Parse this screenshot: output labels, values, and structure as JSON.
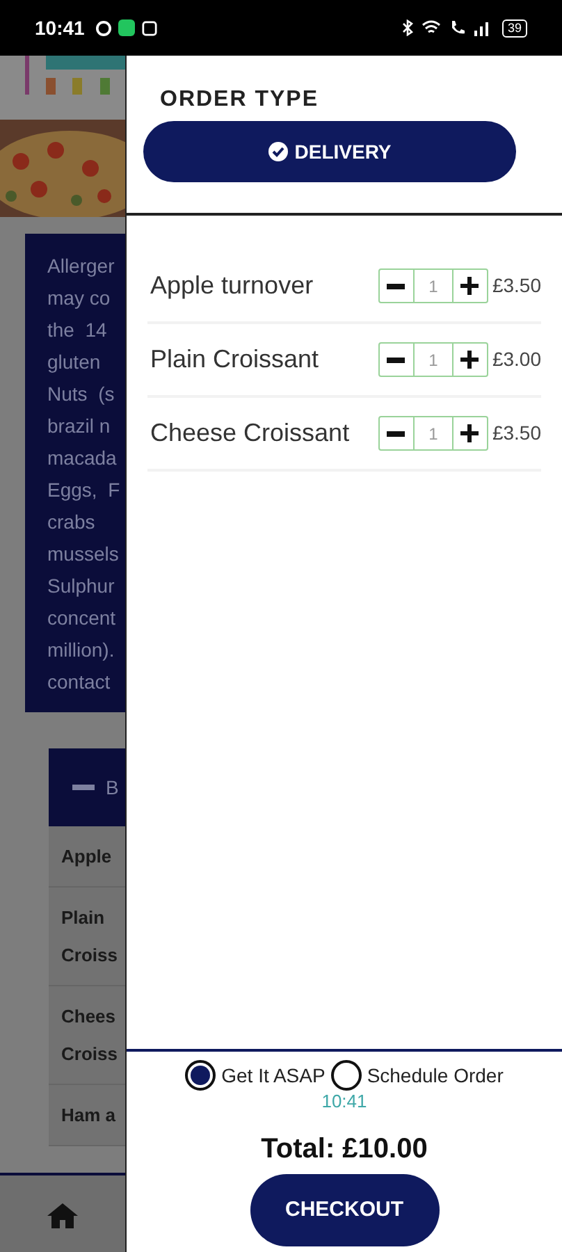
{
  "status_bar": {
    "time": "10:41",
    "battery": "39"
  },
  "background": {
    "allergen_lines": [
      "Allerger",
      "may co",
      "the  14",
      "gluten",
      "Nuts  (s",
      "brazil n",
      "macada",
      "Eggs,  F",
      "crabs",
      "mussels",
      "Sulphur",
      "concent",
      "million).",
      "contact"
    ],
    "panel_header": "B",
    "panel_rows": [
      [
        "Apple"
      ],
      [
        "Plain",
        "Croiss"
      ],
      [
        "Chees",
        "Croiss"
      ],
      [
        "Ham a"
      ]
    ]
  },
  "drawer": {
    "title": "ORDER TYPE",
    "order_type": {
      "label": "DELIVERY",
      "selected": true
    },
    "items": [
      {
        "name": "Apple turnover",
        "quantity": "1",
        "price": "£3.50"
      },
      {
        "name": "Plain Croissant",
        "quantity": "1",
        "price": "£3.00"
      },
      {
        "name": "Cheese Croissant",
        "quantity": "1",
        "price": "£3.50"
      }
    ],
    "timing_options": [
      {
        "label": "Get It ASAP",
        "selected": true
      },
      {
        "label": "Schedule Order",
        "selected": false
      }
    ],
    "time": "10:41",
    "total": "Total: £10.00",
    "checkout": "CHECKOUT"
  }
}
